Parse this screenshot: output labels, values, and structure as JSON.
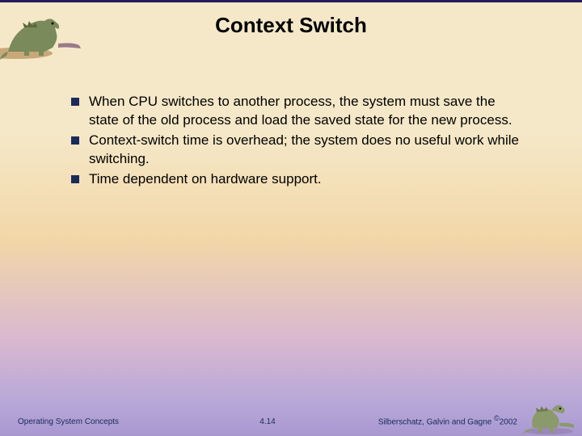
{
  "title": "Context Switch",
  "bullets": [
    "When CPU switches to another process, the system must save the state of the old process and load the saved state for the new process.",
    "Context-switch time is overhead; the system does no useful work while switching.",
    "Time dependent on hardware support."
  ],
  "footer": {
    "left": "Operating System Concepts",
    "center": "4.14",
    "right_prefix": "Silberschatz, Galvin and Gagne ",
    "right_copy": "©",
    "right_year": "2002"
  }
}
